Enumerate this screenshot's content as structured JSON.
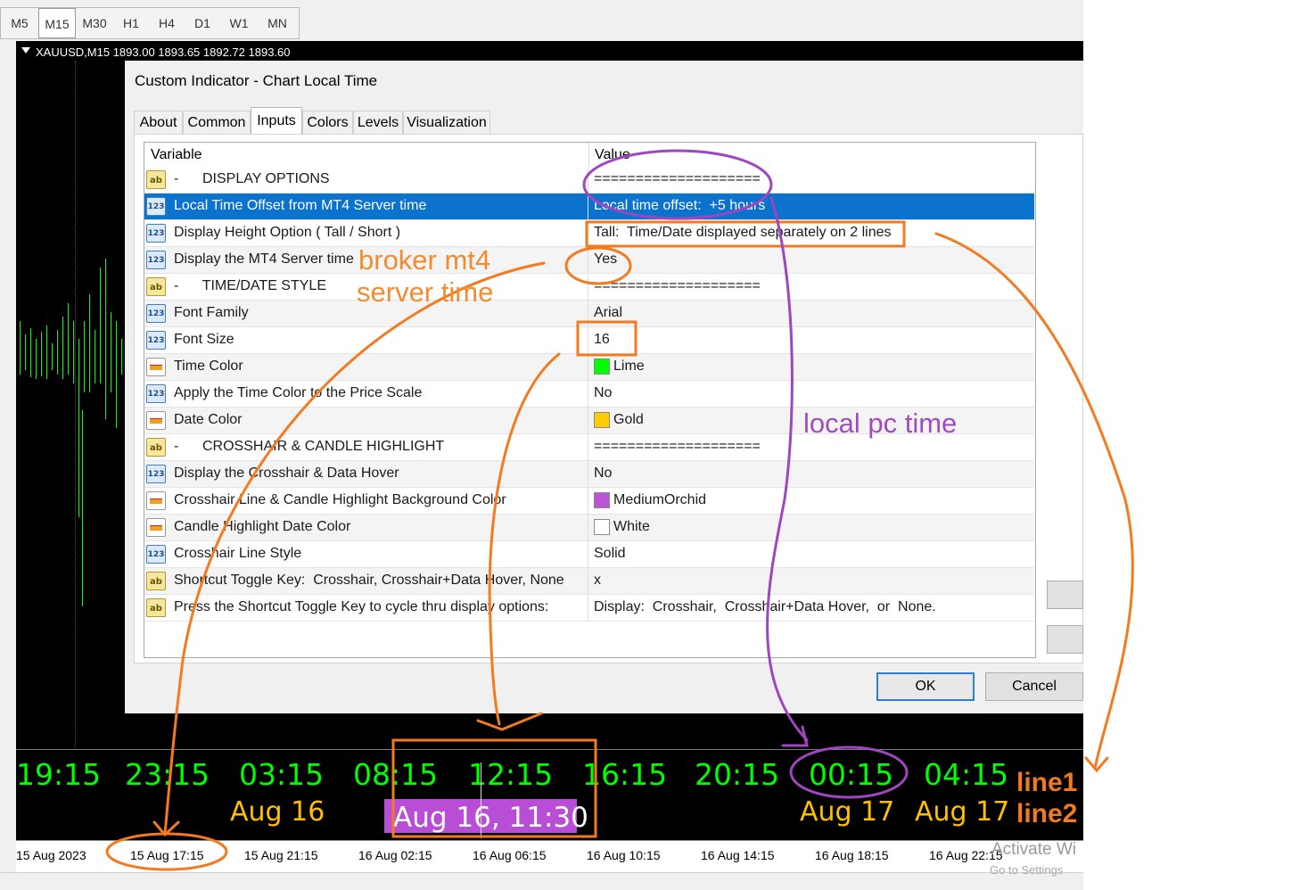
{
  "toolbar": {
    "timeframes": [
      "M5",
      "M15",
      "M30",
      "H1",
      "H4",
      "D1",
      "W1",
      "MN"
    ],
    "active": "M15"
  },
  "chart": {
    "symbol_info": "XAUUSD,M15  1893.00 1893.65 1892.72 1893.60"
  },
  "dialog": {
    "title": "Custom Indicator - Chart Local Time",
    "tabs": [
      "About",
      "Common",
      "Inputs",
      "Colors",
      "Levels",
      "Visualization"
    ],
    "active_tab": "Inputs",
    "columns": {
      "variable": "Variable",
      "value": "Value"
    },
    "rows": [
      {
        "icon": "ab-icon",
        "variable": "-      DISPLAY OPTIONS",
        "value": "===================="
      },
      {
        "icon": "123-icon",
        "variable": "Local Time Offset from MT4 Server time",
        "value": "Local time offset:  +5 hours",
        "selected": true
      },
      {
        "icon": "123-icon",
        "variable": "Display Height Option ( Tall / Short )",
        "value": "Tall:  Time/Date displayed separately on 2 lines"
      },
      {
        "icon": "123-icon",
        "variable": "Display the MT4 Server time",
        "value": "Yes"
      },
      {
        "icon": "ab-icon",
        "variable": "-      TIME/DATE STYLE",
        "value": "===================="
      },
      {
        "icon": "123-icon",
        "variable": "Font Family",
        "value": "Arial"
      },
      {
        "icon": "123-icon",
        "variable": "Font Size",
        "value": "16"
      },
      {
        "icon": "color-icon",
        "variable": "Time Color",
        "value": "Lime",
        "swatch": "#00ff00"
      },
      {
        "icon": "123-icon",
        "variable": "Apply the Time Color to the Price Scale",
        "value": "No"
      },
      {
        "icon": "color-icon",
        "variable": "Date Color",
        "value": "Gold",
        "swatch": "#ffcc00"
      },
      {
        "icon": "ab-icon",
        "variable": "-      CROSSHAIR & CANDLE HIGHLIGHT",
        "value": "===================="
      },
      {
        "icon": "123-icon",
        "variable": "Display the Crosshair & Data Hover",
        "value": "No"
      },
      {
        "icon": "color-icon",
        "variable": "Crosshair Line & Candle Highlight Background Color",
        "value": "MediumOrchid",
        "swatch": "#ba55d3"
      },
      {
        "icon": "color-icon",
        "variable": "Candle Highlight Date Color",
        "value": "White",
        "swatch": "#ffffff"
      },
      {
        "icon": "123-icon",
        "variable": "Crosshair Line Style",
        "value": "Solid"
      },
      {
        "icon": "ab-icon",
        "variable": "Shortcut Toggle Key:  Crosshair, Crosshair+Data Hover, None",
        "value": "x"
      },
      {
        "icon": "ab-icon",
        "variable": "Press the Shortcut Toggle Key to cycle thru display options:",
        "value": "Display:  Crosshair,  Crosshair+Data Hover,  or  None."
      }
    ],
    "ok_label": "OK",
    "cancel_label": "Cancel"
  },
  "time_display": {
    "times": [
      "19:15",
      "23:15",
      "03:15",
      "08:15",
      "12:15",
      "16:15",
      "20:15",
      "00:15",
      "04:15"
    ],
    "dates": [
      "Aug 16",
      "Aug 17",
      "Aug 17"
    ],
    "highlight": "Aug 16, 11:30",
    "time_color": "#00ff00",
    "date_color": "#ffc000",
    "highlight_color": "#b84dd6"
  },
  "time_scale": [
    "15 Aug 2023",
    "15 Aug 17:15",
    "15 Aug 21:15",
    "16 Aug 02:15",
    "16 Aug 06:15",
    "16 Aug 10:15",
    "16 Aug 14:15",
    "16 Aug 18:15",
    "16 Aug 22:15"
  ],
  "annotations": {
    "broker_1": "broker mt4",
    "broker_2": "server time",
    "local": "local pc time",
    "line1": "line1",
    "line2": "line2"
  },
  "watermark": {
    "line1": "Activate Wi",
    "line2": "Go to Settings"
  }
}
